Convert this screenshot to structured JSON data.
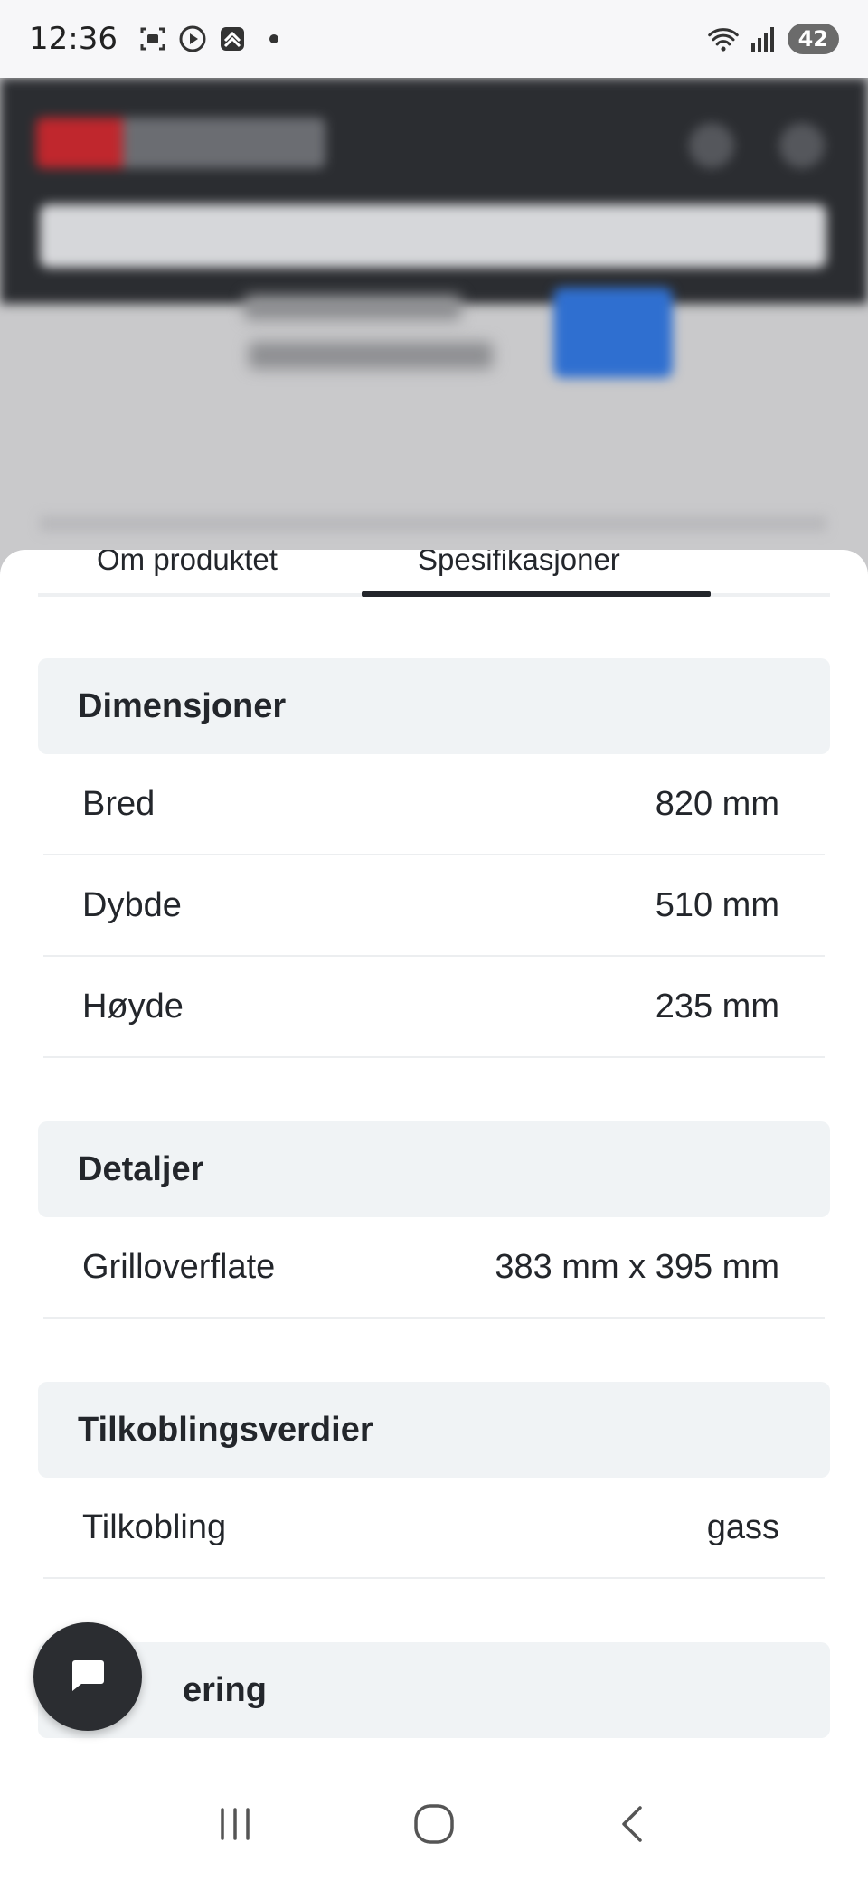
{
  "status_bar": {
    "time": "12:36",
    "battery": "42",
    "icons": [
      "screenshot-icon",
      "media-icon",
      "app-icon",
      "wifi-icon",
      "signal-icon"
    ]
  },
  "tabs": [
    {
      "label": "Om produktet",
      "active": false
    },
    {
      "label": "Spesifikasjoner",
      "active": true
    }
  ],
  "sections": [
    {
      "title": "Dimensjoner",
      "rows": [
        {
          "label": "Bred",
          "value": "820 mm"
        },
        {
          "label": "Dybde",
          "value": "510 mm"
        },
        {
          "label": "Høyde",
          "value": "235 mm"
        }
      ]
    },
    {
      "title": "Detaljer",
      "rows": [
        {
          "label": "Grilloverflate",
          "value": "383 mm x 395 mm"
        }
      ]
    },
    {
      "title": "Tilkoblingsverdier",
      "rows": [
        {
          "label": "Tilkobling",
          "value": "gass"
        }
      ]
    },
    {
      "title": "ering",
      "rows": []
    }
  ],
  "colors": {
    "header_dark": "#2b2d31",
    "section_bg": "#f0f3f5",
    "text": "#23262b",
    "accent_blue": "#2f6fd0"
  },
  "nav_bar": {
    "icons": [
      "recents-icon",
      "home-icon",
      "back-icon"
    ]
  }
}
